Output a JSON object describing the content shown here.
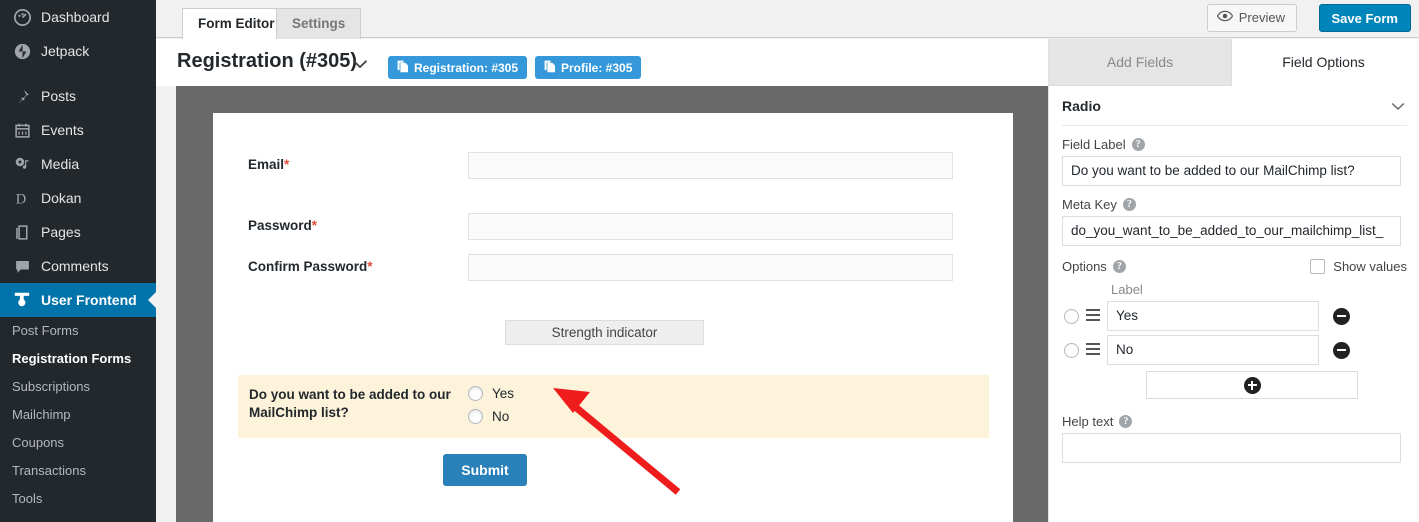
{
  "sidebar": {
    "items": [
      {
        "label": "Dashboard",
        "icon": "dashboard-icon"
      },
      {
        "label": "Jetpack",
        "icon": "jetpack-icon"
      },
      {
        "label": "Posts",
        "icon": "pin-icon"
      },
      {
        "label": "Events",
        "icon": "calendar-icon"
      },
      {
        "label": "Media",
        "icon": "media-icon"
      },
      {
        "label": "Dokan",
        "icon": "dokan-icon"
      },
      {
        "label": "Pages",
        "icon": "pages-icon"
      },
      {
        "label": "Comments",
        "icon": "comment-icon"
      }
    ],
    "active": {
      "label": "User Frontend",
      "icon": "user-frontend-icon"
    },
    "submenu": [
      {
        "label": "Post Forms",
        "current": false
      },
      {
        "label": "Registration Forms",
        "current": true
      },
      {
        "label": "Subscriptions",
        "current": false
      },
      {
        "label": "Mailchimp",
        "current": false
      },
      {
        "label": "Coupons",
        "current": false
      },
      {
        "label": "Transactions",
        "current": false
      },
      {
        "label": "Tools",
        "current": false
      }
    ]
  },
  "topbar": {
    "tabs": [
      {
        "label": "Form Editor",
        "selected": true
      },
      {
        "label": "Settings",
        "selected": false
      }
    ],
    "preview_label": "Preview",
    "save_label": "Save Form"
  },
  "form_header": {
    "title": "Registration (#305)",
    "caret": "chevron-down-icon",
    "shortcodes": [
      {
        "label": "Registration: #305"
      },
      {
        "label": "Profile: #305"
      }
    ]
  },
  "preview": {
    "fields": [
      {
        "label": "Email",
        "required": "*",
        "value": ""
      },
      {
        "label": "Password",
        "required": "*",
        "value": ""
      },
      {
        "label": "Confirm Password",
        "required": "*",
        "value": ""
      }
    ],
    "strength_indicator": "Strength indicator",
    "radio_field": {
      "label": "Do you want to be added to our MailChimp list?",
      "choices": [
        {
          "label": "Yes",
          "checked": false
        },
        {
          "label": "No",
          "checked": false
        }
      ]
    },
    "submit_label": "Submit"
  },
  "panel": {
    "tabs": [
      {
        "label": "Add Fields",
        "active": false
      },
      {
        "label": "Field Options",
        "active": true
      }
    ],
    "section_title": "Radio",
    "field_label_title": "Field Label",
    "field_label_value": "Do you want to be added to our MailChimp list?",
    "meta_key_title": "Meta Key",
    "meta_key_value": "do_you_want_to_be_added_to_our_mailchimp_list_",
    "options_title": "Options",
    "show_values_label": "Show values",
    "options_column_header": "Label",
    "options": [
      {
        "label": "Yes",
        "selected": false
      },
      {
        "label": "No",
        "selected": false
      }
    ],
    "help_text_title": "Help text",
    "help_text_value": ""
  },
  "annotation": {
    "type": "arrow",
    "color": "#ee1c1c"
  },
  "colors": {
    "admin_bg": "#23282d",
    "accent_blue": "#0073aa",
    "button_blue": "#0085ba",
    "shortcode_blue": "#3498db",
    "highlight_row": "#fdf3da",
    "canvas_grey": "#6a6a6a",
    "required_red": "#e04a36"
  }
}
